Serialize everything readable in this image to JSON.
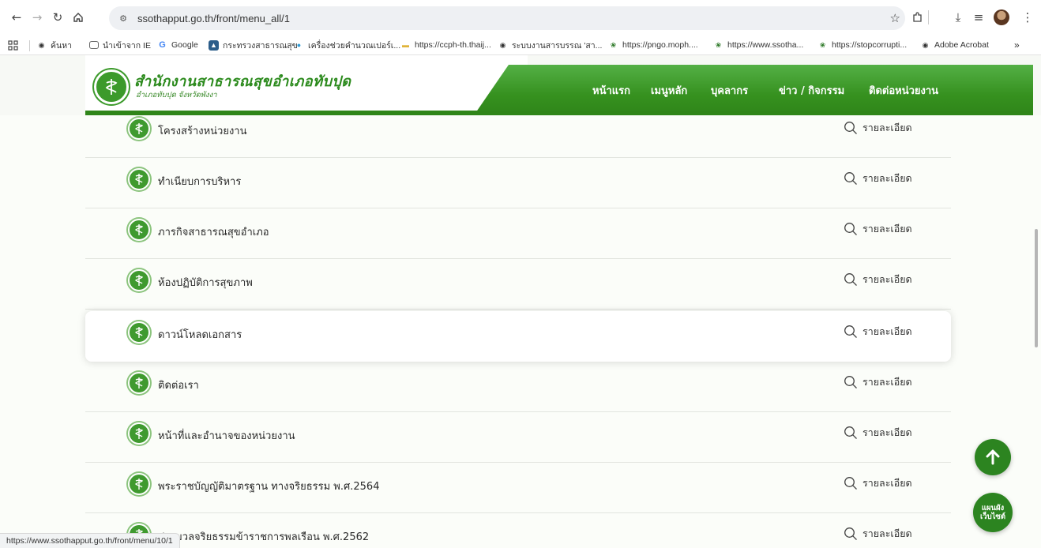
{
  "browser": {
    "url": "ssothapput.go.th/front/menu_all/1",
    "status_url": "https://www.ssothapput.go.th/front/menu/10/1"
  },
  "bookmarks": [
    {
      "label": "ค้นหา",
      "icon": "shield-icon"
    },
    {
      "label": "นำเข้าจาก IE",
      "icon": "folder-icon"
    },
    {
      "label": "Google",
      "icon": "google-icon"
    },
    {
      "label": "กระทรวงสาธารณสุข",
      "icon": "moph-icon"
    },
    {
      "label": "เครื่องช่วยคำนวณเปอร์เ...",
      "icon": "calculator-icon"
    },
    {
      "label": "https://ccph-th.thaij...",
      "icon": "page-icon"
    },
    {
      "label": "ระบบงานสารบรรณ 'สา...",
      "icon": "globe-icon"
    },
    {
      "label": "https://pngo.moph....",
      "icon": "moph-seal-icon"
    },
    {
      "label": "https://www.ssotha...",
      "icon": "moph-seal-icon"
    },
    {
      "label": "https://stopcorrupti...",
      "icon": "moph-seal-icon"
    },
    {
      "label": "Adobe Acrobat",
      "icon": "globe-icon"
    }
  ],
  "site": {
    "title": "สำนักงานสาธารณสุขอำเภอทับปุด",
    "subtitle": "อำเภอทับปุด จังหวัดพังงา",
    "nav": [
      "หน้าแรก",
      "เมนูหลัก",
      "บุคลากร",
      "ข่าว / กิจกรรม",
      "ติดต่อหน่วยงาน"
    ]
  },
  "menu_rows": [
    {
      "title": "โครงสร้างหน่วยงาน",
      "detail": "รายละเอียด"
    },
    {
      "title": "ทำเนียบการบริหาร",
      "detail": "รายละเอียด"
    },
    {
      "title": "ภารกิจสาธารณสุขอำเภอ",
      "detail": "รายละเอียด"
    },
    {
      "title": "ห้องปฏิบัติการสุขภาพ",
      "detail": "รายละเอียด"
    },
    {
      "title": "ดาวน์โหลดเอกสาร",
      "detail": "รายละเอียด"
    },
    {
      "title": "ติดต่อเรา",
      "detail": "รายละเอียด"
    },
    {
      "title": "หน้าที่และอำนาจของหน่วยงาน",
      "detail": "รายละเอียด"
    },
    {
      "title": "พระราชบัญญัติมาตรฐาน ทางจริยธรรม พ.ศ.2564",
      "detail": "รายละเอียด"
    },
    {
      "title": "ประมวลจริยธรรมข้าราชการพลเรือน พ.ศ.2562",
      "detail": "รายละเอียด"
    }
  ],
  "sitemap_button": {
    "line1": "แผนผัง",
    "line2": "เว็บไซต์"
  },
  "colors": {
    "brand_green": "#2f8519",
    "accent_green": "#54b046"
  }
}
